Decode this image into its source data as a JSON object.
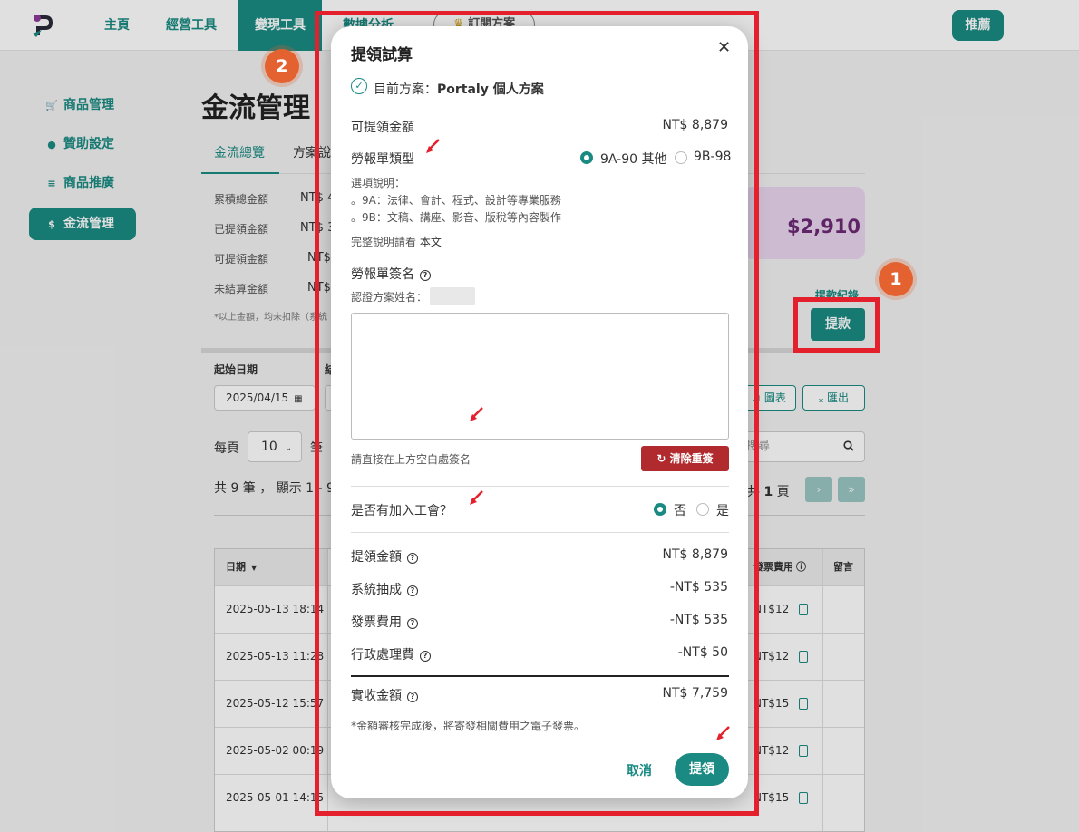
{
  "nav": {
    "items": [
      "主頁",
      "經營工具",
      "變現工具",
      "數據分析"
    ],
    "active": "變現工具",
    "subscribe_pill": "訂閱方案",
    "recommend_button": "推薦"
  },
  "sidebar": {
    "items": [
      {
        "label": "商品管理",
        "icon": "cart-icon"
      },
      {
        "label": "贊助設定",
        "icon": "coin-icon"
      },
      {
        "label": "商品推廣",
        "icon": "coins-icon"
      },
      {
        "label": "金流管理",
        "icon": "dollar-icon",
        "active": true
      }
    ]
  },
  "page": {
    "title": "金流管理",
    "tabs": [
      "金流總覽",
      "方案說"
    ],
    "summary": {
      "labels": [
        "累積總金額",
        "已提領金額",
        "可提領金額",
        "未結算金額"
      ],
      "values": [
        "NT$ 4",
        "NT$ 3",
        "NT$",
        "NT$"
      ],
      "note": "*以上金額，均未扣除（系統"
    },
    "promo_amount": "$2,910",
    "record_link": "提款紀錄",
    "withdraw_button": "提款",
    "start_date_label": "起始日期",
    "end_date_label": "結",
    "start_date_value": "2025/04/15",
    "chart_button": "圖表",
    "export_button": "匯出",
    "per_page_label": "每頁",
    "per_page_value": "10",
    "per_page_suffix": "筆",
    "search_placeholder": "搜尋",
    "count_text": "共 9 筆 ， 顯示 1 - 9",
    "page_text_prefix": "共",
    "page_number": "1",
    "page_text_suffix": "頁",
    "next_page": "›",
    "last_page": "»"
  },
  "table": {
    "headers": {
      "date": "日期",
      "fee": "發票費用",
      "note": "留言"
    },
    "rows": [
      {
        "date": "2025-05-13 18:14",
        "fee": "NT$12"
      },
      {
        "date": "2025-05-13 11:28",
        "fee": "NT$12"
      },
      {
        "date": "2025-05-12 15:57",
        "fee": "NT$15"
      },
      {
        "date": "2025-05-02 00:19",
        "fee": "NT$12"
      },
      {
        "date": "2025-05-01 14:15",
        "fee": "NT$15"
      }
    ]
  },
  "modal": {
    "title": "提領試算",
    "current_plan_label": "目前方案：",
    "current_plan_name": "Portaly 個人方案",
    "available_label": "可提領金額",
    "available_value": "NT$ 8,879",
    "form_type_label": "勞報單類型",
    "form_type_options": [
      "9A-90 其他",
      "9B-98"
    ],
    "form_type_selected": "9A-90 其他",
    "options_heading": "選項說明：",
    "option_9a": "。9A：法律、會計、程式、設計等專業服務",
    "option_9b": "。9B：文稿、講座、影音、版稅等內容製作",
    "full_desc_prefix": "完整說明請看",
    "full_desc_link": "本文",
    "signature_label": "勞報單簽名",
    "cert_name_label": "認證方案姓名：",
    "sign_hint": "請直接在上方空白處簽名",
    "clear_button": "清除重簽",
    "union_label": "是否有加入工會？",
    "union_options": [
      "否",
      "是"
    ],
    "union_selected": "否",
    "breakdown": [
      {
        "label": "提領金額",
        "value": "NT$ 8,879"
      },
      {
        "label": "系統抽成",
        "value": "-NT$ 535"
      },
      {
        "label": "發票費用",
        "value": "-NT$ 535"
      },
      {
        "label": "行政處理費",
        "value": "-NT$ 50"
      }
    ],
    "net_label": "實收金額",
    "net_value": "NT$ 7,759",
    "footnote": "*金額審核完成後，將寄發相關費用之電子發票。",
    "cancel_button": "取消",
    "submit_button": "提領"
  },
  "annotations": {
    "step_badges": [
      "1",
      "2"
    ],
    "highlight_color": "#e3202b",
    "badge_color": "#e4622f"
  },
  "colors": {
    "accent": "#1a8a82",
    "danger": "#b02a2e",
    "promo_text": "#6b2a74"
  }
}
